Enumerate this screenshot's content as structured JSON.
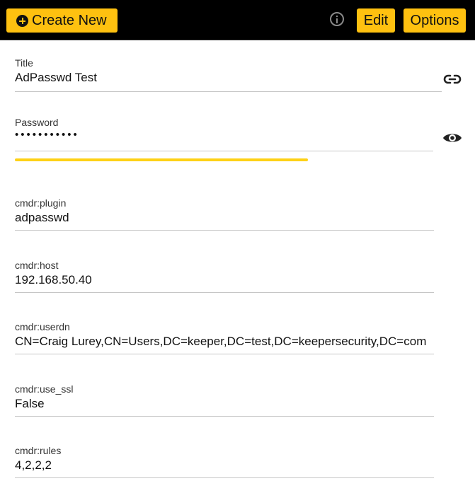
{
  "toolbar": {
    "create_label": "Create New",
    "edit_label": "Edit",
    "options_label": "Options",
    "icons": [
      "plus-circle-icon",
      "info-icon"
    ]
  },
  "record": {
    "title": {
      "label": "Title",
      "value": "AdPasswd Test"
    },
    "password": {
      "label": "Password",
      "masked": "•••••••••••",
      "strength_fraction": 0.67
    },
    "fields": [
      {
        "label": "cmdr:plugin",
        "value": "adpasswd"
      },
      {
        "label": "cmdr:host",
        "value": "192.168.50.40"
      },
      {
        "label": "cmdr:userdn",
        "value": "CN=Craig Lurey,CN=Users,DC=keeper,DC=test,DC=keepersecurity,DC=com"
      },
      {
        "label": "cmdr:use_ssl",
        "value": "False"
      },
      {
        "label": "cmdr:rules",
        "value": "4,2,2,2"
      }
    ]
  },
  "colors": {
    "accent": "#fec110",
    "toolbar_bg": "#000000",
    "strength": "#fed116",
    "divider": "#c6c6c6"
  }
}
